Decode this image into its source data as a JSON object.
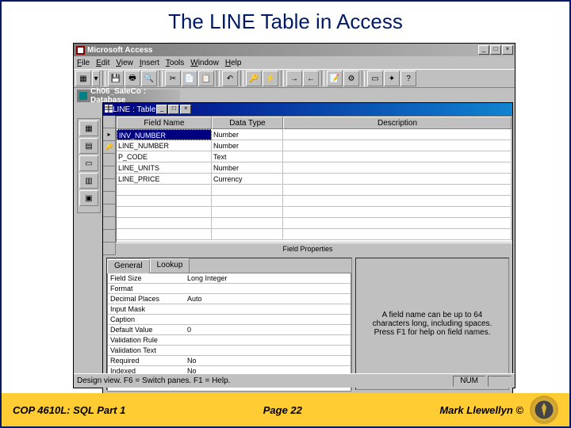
{
  "slide": {
    "title": "The LINE Table in Access",
    "footer_left": "COP 4610L: SQL Part 1",
    "footer_center": "Page 22",
    "footer_right": "Mark Llewellyn ©"
  },
  "app": {
    "title": "Microsoft Access",
    "menu": [
      "File",
      "Edit",
      "View",
      "Insert",
      "Tools",
      "Window",
      "Help"
    ],
    "db_window_title": "Ch06_SaleCo : Database",
    "statusbar_text": "Design view.  F6 = Switch panes.  F1 = Help.",
    "numlock": "NUM"
  },
  "table_window": {
    "title": "LINE : Table",
    "columns": {
      "name": "Field Name",
      "type": "Data Type",
      "desc": "Description"
    },
    "rows": [
      {
        "name": "INV_NUMBER",
        "type": "Number",
        "key": true,
        "current": true
      },
      {
        "name": "LINE_NUMBER",
        "type": "Number",
        "key": true
      },
      {
        "name": "P_CODE",
        "type": "Text"
      },
      {
        "name": "LINE_UNITS",
        "type": "Number"
      },
      {
        "name": "LINE_PRICE",
        "type": "Currency"
      }
    ],
    "props_label": "Field Properties",
    "tabs": [
      "General",
      "Lookup"
    ],
    "properties": [
      {
        "label": "Field Size",
        "value": "Long Integer"
      },
      {
        "label": "Format",
        "value": ""
      },
      {
        "label": "Decimal Places",
        "value": "Auto"
      },
      {
        "label": "Input Mask",
        "value": ""
      },
      {
        "label": "Caption",
        "value": ""
      },
      {
        "label": "Default Value",
        "value": "0"
      },
      {
        "label": "Validation Rule",
        "value": ""
      },
      {
        "label": "Validation Text",
        "value": ""
      },
      {
        "label": "Required",
        "value": "No"
      },
      {
        "label": "Indexed",
        "value": "No"
      }
    ],
    "help_text": "A field name can be up to 64 characters long, including spaces. Press F1 for help on field names."
  }
}
